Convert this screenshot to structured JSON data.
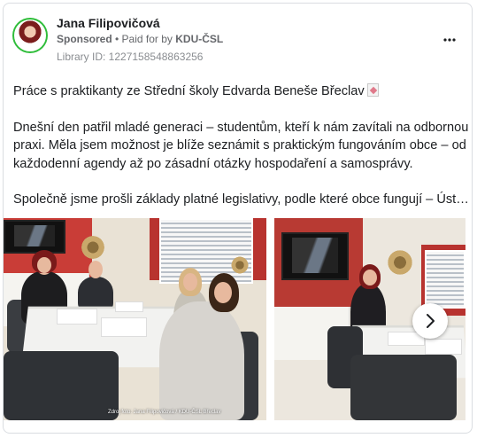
{
  "header": {
    "page_name": "Jana Filipovičová",
    "sponsored": "Sponsored",
    "paid_for_prefix": "• Paid for by",
    "paid_for_by": "KDU-ČSL",
    "library_id": "Library ID: 1227158548863256",
    "more_icon": "more-horizontal-icon"
  },
  "post": {
    "line1": "Práce s praktikanty ze Střední školy Edvarda Beneše Břeclav",
    "line1_icon": "memo-icon",
    "para2": "Dnešní den patřil mladé generaci – studentům, kteří k nám zavítali na odbornou praxi. Měla jsem možnost je blíže seznámit s praktickým fungováním obce – od každodenní agendy až po zásadní otázky hospodaření a samosprávy.",
    "para3": "Společně jsme prošli základy platné legislativy, podle které obce fungují – Ústavo…"
  },
  "carousel": {
    "slide1_caption": "Zdroj foto: Jana Filipovičová / KDU-ČSL Břeclav",
    "next_icon": "chevron-right-icon"
  },
  "colors": {
    "ring": "#2fbd3a",
    "text": "#1c1e21",
    "muted": "#65676b"
  }
}
